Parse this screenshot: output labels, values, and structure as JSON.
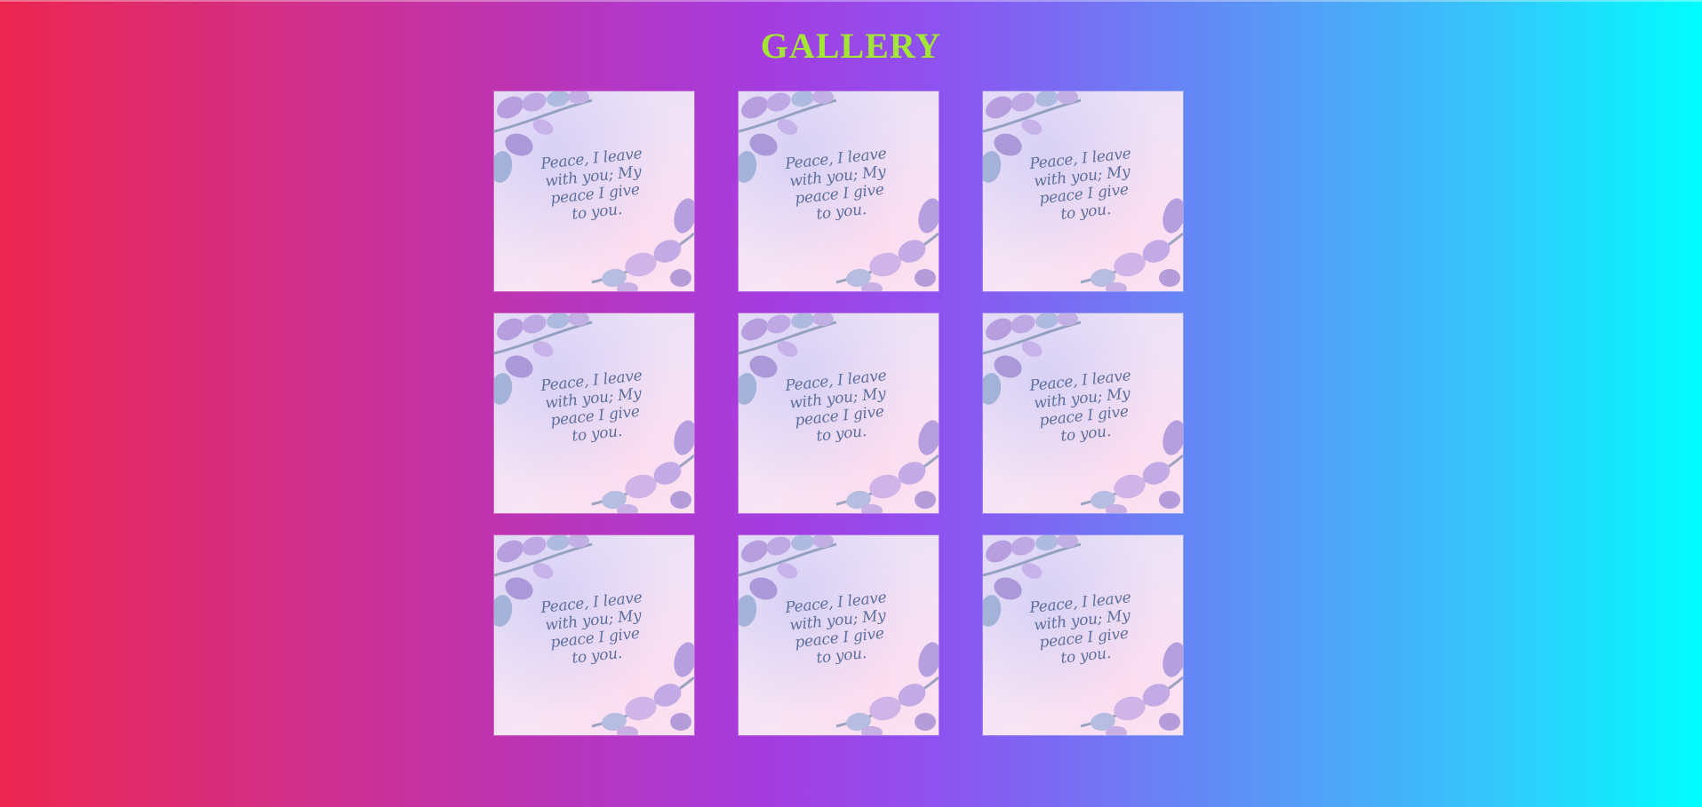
{
  "page": {
    "title": "GALLERY",
    "title_color": "#a3e635"
  },
  "gallery": {
    "items": [
      {
        "lines": [
          "Peace, I leave",
          "with you; My",
          "peace I give",
          "to you."
        ]
      },
      {
        "lines": [
          "Peace, I leave",
          "with you; My",
          "peace I give",
          "to you."
        ]
      },
      {
        "lines": [
          "Peace, I leave",
          "with you; My",
          "peace I give",
          "to you."
        ]
      },
      {
        "lines": [
          "Peace, I leave",
          "with you; My",
          "peace I give",
          "to you."
        ]
      },
      {
        "lines": [
          "Peace, I leave",
          "with you; My",
          "peace I give",
          "to you."
        ]
      },
      {
        "lines": [
          "Peace, I leave",
          "with you; My",
          "peace I give",
          "to you."
        ]
      },
      {
        "lines": [
          "Peace, I leave",
          "with you; My",
          "peace I give",
          "to you."
        ]
      },
      {
        "lines": [
          "Peace, I leave",
          "with you; My",
          "peace I give",
          "to you."
        ]
      },
      {
        "lines": [
          "Peace, I leave",
          "with you; My",
          "peace I give",
          "to you."
        ]
      }
    ]
  }
}
